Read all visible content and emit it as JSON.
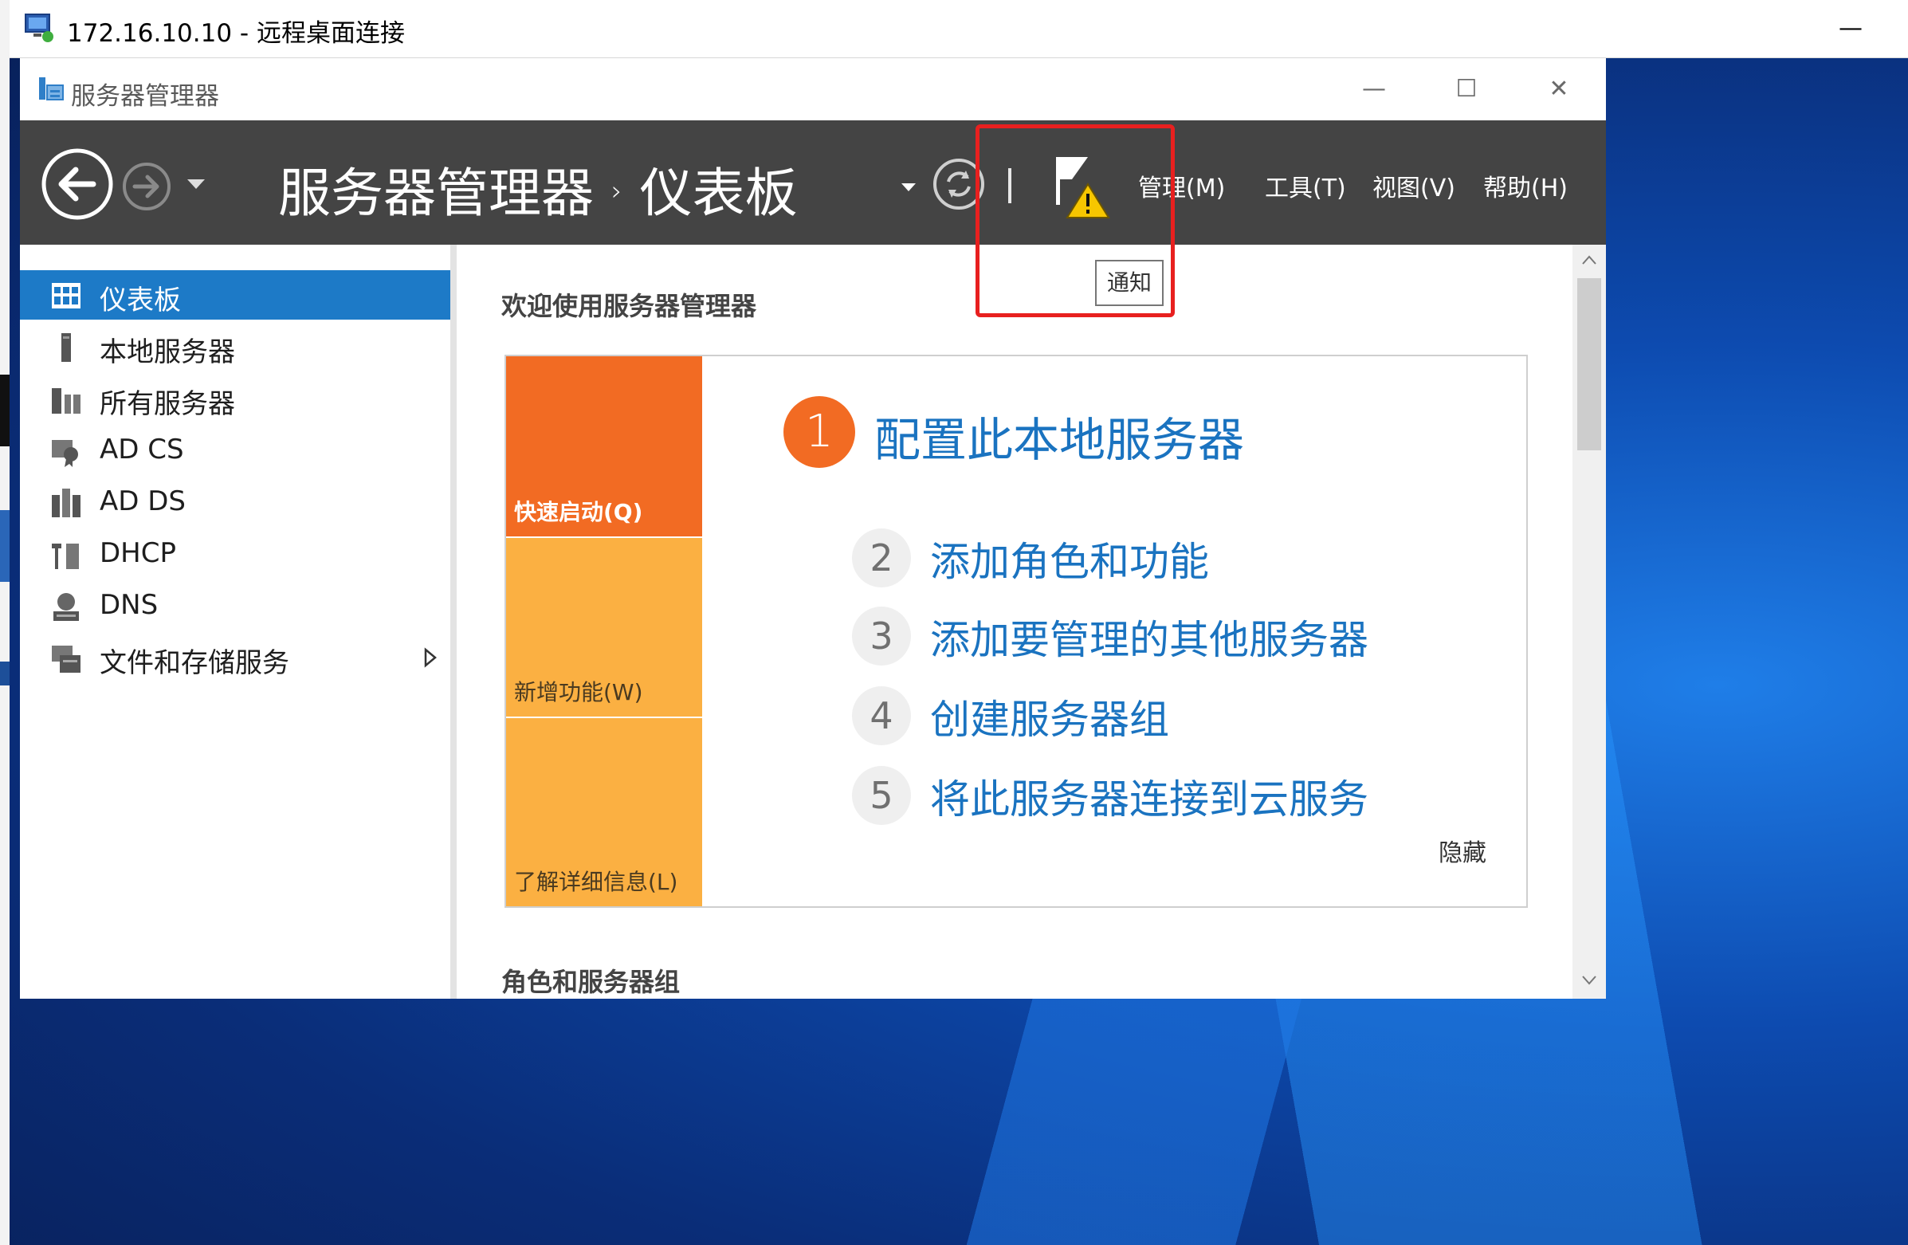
{
  "rdp": {
    "title": "172.16.10.10 - 远程桌面连接",
    "minimize_glyph": "—"
  },
  "window": {
    "title": "服务器管理器",
    "controls": {
      "minimize": "—",
      "maximize": "☐",
      "close": "✕"
    }
  },
  "header": {
    "breadcrumb_root": "服务器管理器",
    "breadcrumb_separator": "›",
    "breadcrumb_current": "仪表板",
    "refresh_icon": "refresh-icon",
    "flag_icon": "flag-warning-icon",
    "divider": "|",
    "menu": [
      {
        "label": "管理(M)"
      },
      {
        "label": "工具(T)"
      },
      {
        "label": "视图(V)"
      },
      {
        "label": "帮助(H)"
      }
    ],
    "tooltip": "通知"
  },
  "sidebar": {
    "items": [
      {
        "label": "仪表板",
        "icon": "dashboard-icon",
        "active": true
      },
      {
        "label": "本地服务器",
        "icon": "server-icon"
      },
      {
        "label": "所有服务器",
        "icon": "servers-icon"
      },
      {
        "label": "AD CS",
        "icon": "certificate-icon"
      },
      {
        "label": "AD DS",
        "icon": "directory-icon"
      },
      {
        "label": "DHCP",
        "icon": "dhcp-icon"
      },
      {
        "label": "DNS",
        "icon": "dns-icon"
      },
      {
        "label": "文件和存储服务",
        "icon": "file-storage-icon",
        "expandable": true
      }
    ]
  },
  "main": {
    "welcome_title": "欢迎使用服务器管理器",
    "tiles": [
      {
        "label": "快速启动(Q)"
      },
      {
        "label": "新增功能(W)"
      },
      {
        "label": "了解详细信息(L)"
      }
    ],
    "steps": [
      {
        "number": "1",
        "label": "配置此本地服务器"
      },
      {
        "number": "2",
        "label": "添加角色和功能"
      },
      {
        "number": "3",
        "label": "添加要管理的其他服务器"
      },
      {
        "number": "4",
        "label": "创建服务器组"
      },
      {
        "number": "5",
        "label": "将此服务器连接到云服务"
      }
    ],
    "hide_label": "隐藏",
    "roles_heading": "角色和服务器组"
  },
  "colors": {
    "header_bg": "#444444",
    "accent_orange": "#f26b23",
    "tile_yellow": "#fbb042",
    "link_blue": "#1a73c0",
    "sidebar_active": "#1d7ac7",
    "highlight_red": "#e8201f"
  }
}
